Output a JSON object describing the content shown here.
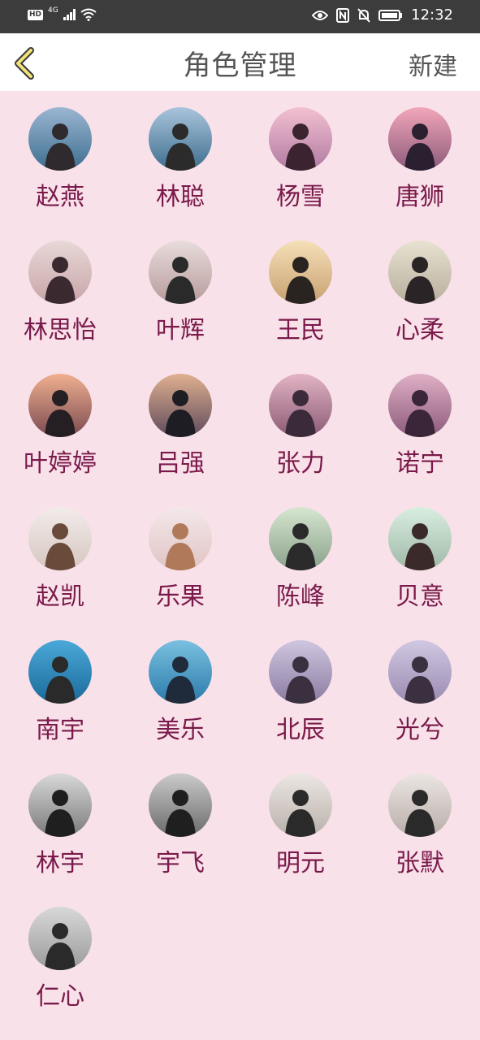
{
  "status_bar": {
    "network": "4G",
    "time": "12:32"
  },
  "header": {
    "back_icon": "chevron-left-icon",
    "title": "角色管理",
    "new_label": "新建"
  },
  "roles": [
    {
      "name": "赵燕",
      "palette": [
        "#9ab6d2",
        "#3d6d8e",
        "#2e2a2e"
      ]
    },
    {
      "name": "林聪",
      "palette": [
        "#a9c4dc",
        "#3d6d8e",
        "#2b2b2b"
      ]
    },
    {
      "name": "杨雪",
      "palette": [
        "#f3c0d2",
        "#b07aa0",
        "#3b2430"
      ]
    },
    {
      "name": "唐狮",
      "palette": [
        "#f2a6b9",
        "#8b5a7a",
        "#2a2030"
      ]
    },
    {
      "name": "林思怡",
      "palette": [
        "#e8d8d8",
        "#c8a4a6",
        "#3a2a30"
      ]
    },
    {
      "name": "叶辉",
      "palette": [
        "#e8dcdc",
        "#b89a9a",
        "#2a2a2a"
      ]
    },
    {
      "name": "王民",
      "palette": [
        "#f5e0b8",
        "#c8a070",
        "#2a2420"
      ]
    },
    {
      "name": "心柔",
      "palette": [
        "#e8e2d2",
        "#b8ae9c",
        "#2a2426"
      ]
    },
    {
      "name": "叶婷婷",
      "palette": [
        "#f0b090",
        "#7a4a50",
        "#251f24"
      ]
    },
    {
      "name": "吕强",
      "palette": [
        "#e0b090",
        "#5e4a5a",
        "#1f1d24"
      ]
    },
    {
      "name": "张力",
      "palette": [
        "#e2b4c4",
        "#8a5a74",
        "#3a2a3a"
      ]
    },
    {
      "name": "诺宁",
      "palette": [
        "#e0b0c6",
        "#8a5a7a",
        "#3a2638"
      ]
    },
    {
      "name": "赵凯",
      "palette": [
        "#f2ecea",
        "#d6c6c0",
        "#6a4a3a"
      ]
    },
    {
      "name": "乐果",
      "palette": [
        "#f4e8ea",
        "#e0c4c4",
        "#b07a5a"
      ]
    },
    {
      "name": "陈峰",
      "palette": [
        "#d6e6d0",
        "#8aa08a",
        "#2a2a2a"
      ]
    },
    {
      "name": "贝意",
      "palette": [
        "#d8eee0",
        "#a0b8a6",
        "#3a2a2a"
      ]
    },
    {
      "name": "南宇",
      "palette": [
        "#4aa8d8",
        "#1a6a9a",
        "#2a2a2a"
      ]
    },
    {
      "name": "美乐",
      "palette": [
        "#7ac0e0",
        "#2a7aaa",
        "#1f2a3a"
      ]
    },
    {
      "name": "北辰",
      "palette": [
        "#cfc6e0",
        "#8a7aa0",
        "#3a3040"
      ]
    },
    {
      "name": "光兮",
      "palette": [
        "#d0c8e2",
        "#9a8ab0",
        "#3a3040"
      ]
    },
    {
      "name": "林宇",
      "palette": [
        "#d8d8d8",
        "#7a7a7a",
        "#1f1f1f"
      ]
    },
    {
      "name": "宇飞",
      "palette": [
        "#cacaca",
        "#6a6a6a",
        "#1f1f1f"
      ]
    },
    {
      "name": "明元",
      "palette": [
        "#ece6e2",
        "#b8b0aa",
        "#2a2a2a"
      ]
    },
    {
      "name": "张默",
      "palette": [
        "#ebe6e2",
        "#b8aca8",
        "#2a2a2a"
      ]
    },
    {
      "name": "仁心",
      "palette": [
        "#d8d8d8",
        "#9a9a9a",
        "#2a2a2a"
      ]
    }
  ]
}
